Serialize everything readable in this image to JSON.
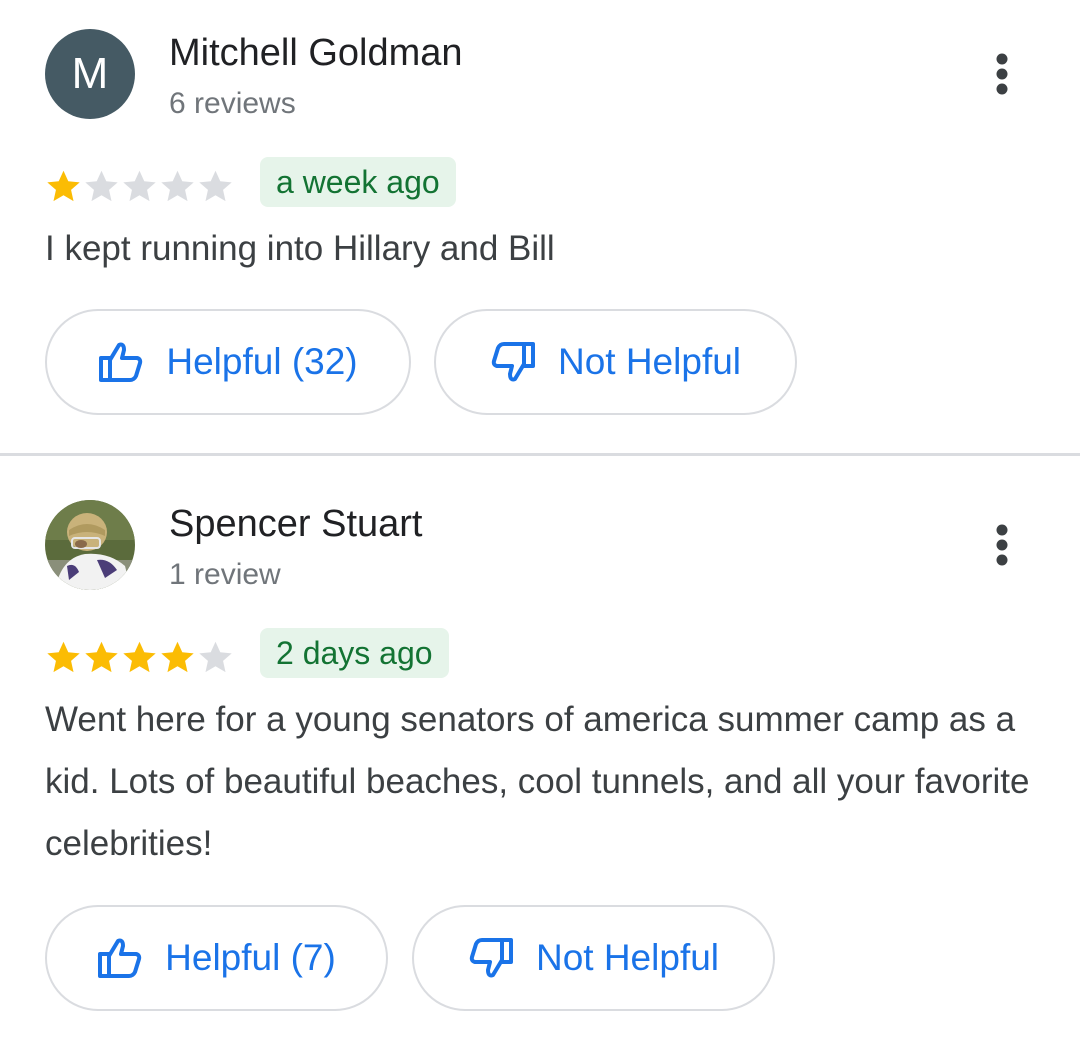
{
  "reviews": [
    {
      "avatar_letter": "M",
      "avatar_color": "#455a64",
      "name": "Mitchell Goldman",
      "review_count": "6 reviews",
      "rating": 1,
      "rating_max": 5,
      "time": "a week ago",
      "text": "I kept running into Hillary and Bill",
      "helpful_label": "Helpful (32)",
      "not_helpful_label": "Not Helpful",
      "menu_icon": "more-vert-icon"
    },
    {
      "avatar_photo": "football-player-photo",
      "name": "Spencer Stuart",
      "review_count": "1 review",
      "rating": 4,
      "rating_max": 5,
      "time": "2 days ago",
      "text": "Went here for a young senators of america summer camp as a kid. Lots of beautiful beaches, cool tunnels, and all your favorite celebrities!",
      "helpful_label": "Helpful (7)",
      "not_helpful_label": "Not Helpful",
      "menu_icon": "more-vert-icon"
    }
  ],
  "colors": {
    "star_filled": "#fbbc04",
    "star_empty": "#dadce0",
    "badge_bg": "#e6f4ea",
    "badge_text": "#137333",
    "link_blue": "#1a73e8",
    "secondary_text": "#70757a"
  }
}
